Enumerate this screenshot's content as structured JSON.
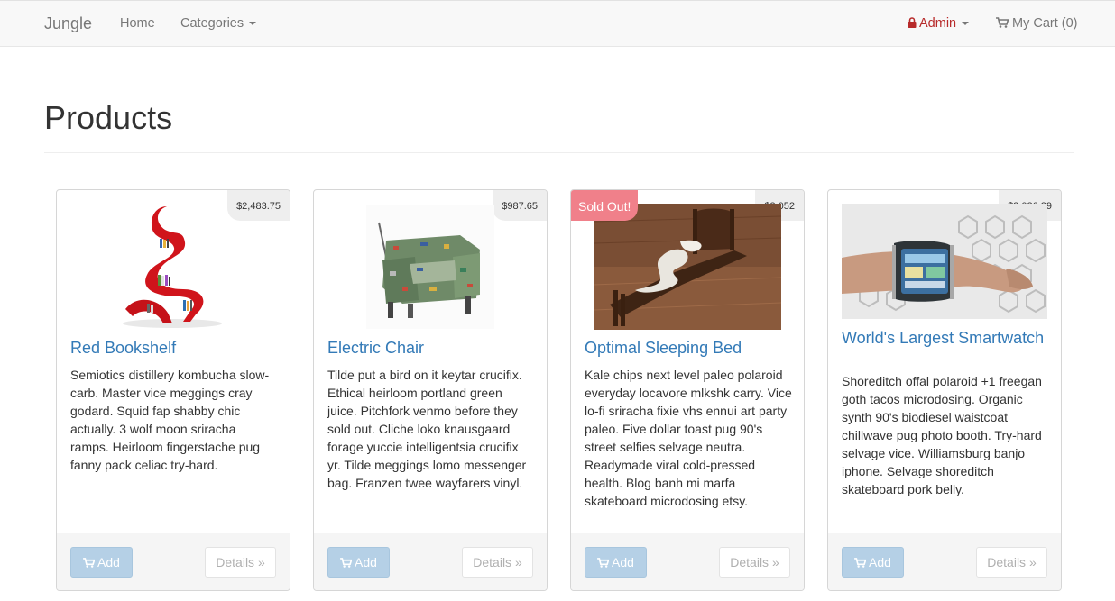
{
  "navbar": {
    "brand": "Jungle",
    "home": "Home",
    "categories": "Categories",
    "admin": "Admin",
    "cart": "My Cart (0)",
    "admin_color": "#b72a2a"
  },
  "page": {
    "title": "Products"
  },
  "products": [
    {
      "name": "Red Bookshelf",
      "price": "$2,483.75",
      "sold_out": "",
      "description": "Semiotics distillery kombucha slow-carb. Master vice meggings cray godard. Squid fap shabby chic actually. 3 wolf moon sriracha ramps. Heirloom fingerstache pug fanny pack celiac try-hard.",
      "add_label": "Add",
      "details_label": "Details »"
    },
    {
      "name": "Electric Chair",
      "price": "$987.65",
      "sold_out": "",
      "description": "Tilde put a bird on it keytar crucifix. Ethical heirloom portland green juice. Pitchfork venmo before they sold out. Cliche loko knausgaard forage yuccie intelligentsia crucifix yr. Tilde meggings lomo messenger bag. Franzen twee wayfarers vinyl.",
      "add_label": "Add",
      "details_label": "Details »"
    },
    {
      "name": "Optimal Sleeping Bed",
      "price": "$3,052",
      "sold_out": "Sold Out!",
      "description": "Kale chips next level paleo polaroid everyday locavore mlkshk carry. Vice lo-fi sriracha fixie vhs ennui art party paleo. Five dollar toast pug 90's street selfies selvage neutra. Readymade viral cold-pressed health. Blog banh mi marfa skateboard microdosing etsy.",
      "add_label": "Add",
      "details_label": "Details »"
    },
    {
      "name": "World's Largest Smartwatch",
      "price": "$2,026.29",
      "sold_out": "",
      "description": "Shoreditch offal polaroid +1 freegan goth tacos microdosing. Organic synth 90's biodiesel waistcoat chillwave pug photo booth. Try-hard selvage vice. Williamsburg banjo iphone. Selvage shoreditch skateboard pork belly.",
      "add_label": "Add",
      "details_label": "Details »"
    }
  ]
}
